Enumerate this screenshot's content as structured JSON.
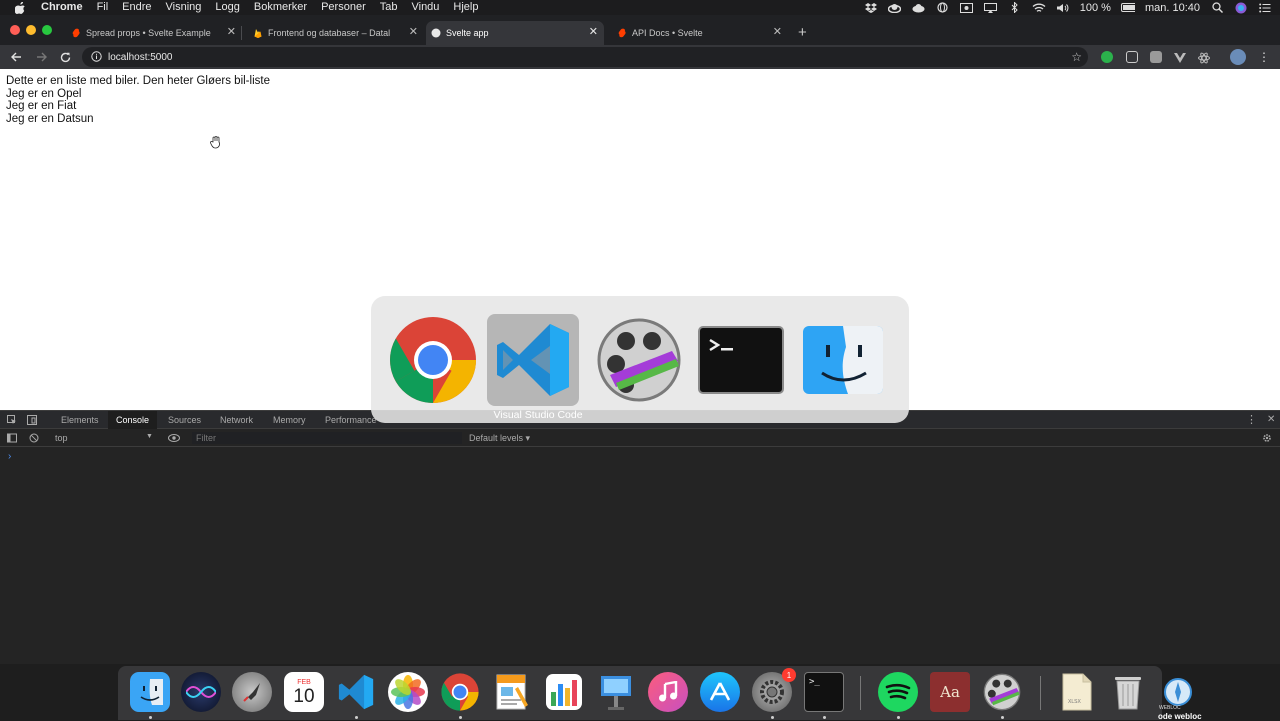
{
  "menubar": {
    "app_name": "Chrome",
    "items": [
      "Fil",
      "Endre",
      "Visning",
      "Logg",
      "Bokmerker",
      "Personer",
      "Tab",
      "Vindu",
      "Hjelp"
    ],
    "battery": "100 %",
    "clock": "man. 10:40"
  },
  "tabs": [
    {
      "title": "Spread props • Svelte Example",
      "favicon": "svelte-icon"
    },
    {
      "title": "Frontend og databaser – Datal",
      "favicon": "firebase-icon"
    },
    {
      "title": "Svelte app",
      "favicon": "svelte-icon",
      "active": true
    },
    {
      "title": "API Docs • Svelte",
      "favicon": "svelte-icon"
    }
  ],
  "address_bar": {
    "url": "localhost:5000"
  },
  "page": {
    "lines": [
      "Dette er en liste med biler. Den heter Gløers bil-liste",
      "Jeg er en Opel",
      "Jeg er en Fiat",
      "Jeg er en Datsun"
    ]
  },
  "devtools": {
    "tabs": [
      "Elements",
      "Console",
      "Sources",
      "Network",
      "Memory",
      "Performance"
    ],
    "active_tab": "Console",
    "context": "top",
    "filter_placeholder": "Filter",
    "levels": "Default levels ▾"
  },
  "app_switcher": {
    "apps": [
      "chrome-icon",
      "vscode-icon",
      "final-cut-icon",
      "terminal-icon",
      "finder-icon"
    ],
    "selected_label": "Visual Studio Code"
  },
  "dock": {
    "calendar_month": "FEB",
    "calendar_day": "10",
    "system_prefs_badge": "1",
    "terminal_prompt": ">_",
    "dictionary_glyph": "Aa",
    "xlsx_label": "XLSX",
    "webloc_label": "WEBLOC",
    "caption": "ode webloc"
  },
  "colors": {
    "accent_blue": "#4d8ef0",
    "svelte_orange": "#ff3e00",
    "vscode_blue": "#23a9f2"
  }
}
